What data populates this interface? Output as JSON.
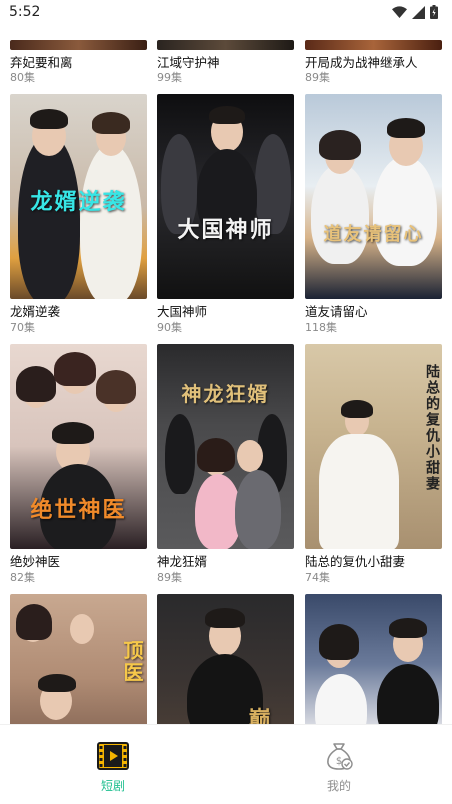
{
  "status_bar": {
    "time": "5:52"
  },
  "partial_top_row": [
    {
      "title": "弃妃要和离",
      "episodes": "80集"
    },
    {
      "title": "江域守护神",
      "episodes": "99集"
    },
    {
      "title": "开局成为战神继承人",
      "episodes": "89集"
    }
  ],
  "row2": [
    {
      "title": "龙婿逆袭",
      "episodes": "70集",
      "poster_text": "龙婿逆袭"
    },
    {
      "title": "大国神师",
      "episodes": "90集",
      "poster_text": "大国神师"
    },
    {
      "title": "道友请留心",
      "episodes": "118集",
      "poster_text": "道友请留心"
    }
  ],
  "row3": [
    {
      "title": "绝妙神医",
      "episodes": "82集",
      "poster_text": "绝世神医"
    },
    {
      "title": "神龙狂婿",
      "episodes": "89集",
      "poster_text": "神龙狂婿"
    },
    {
      "title": "陆总的复仇小甜妻",
      "episodes": "74集",
      "poster_text": "陆总的复仇小甜妻"
    }
  ],
  "row4": [
    {
      "poster_text": "顶医"
    },
    {
      "poster_text": "巅"
    },
    {
      "poster_text": ""
    }
  ],
  "tabs": [
    {
      "label": "短剧",
      "icon": "film-icon",
      "active": true
    },
    {
      "label": "我的",
      "icon": "money-bag-icon",
      "active": false
    }
  ],
  "colors": {
    "accent": "#1fbf8f",
    "inactive": "#8e8e8e"
  }
}
